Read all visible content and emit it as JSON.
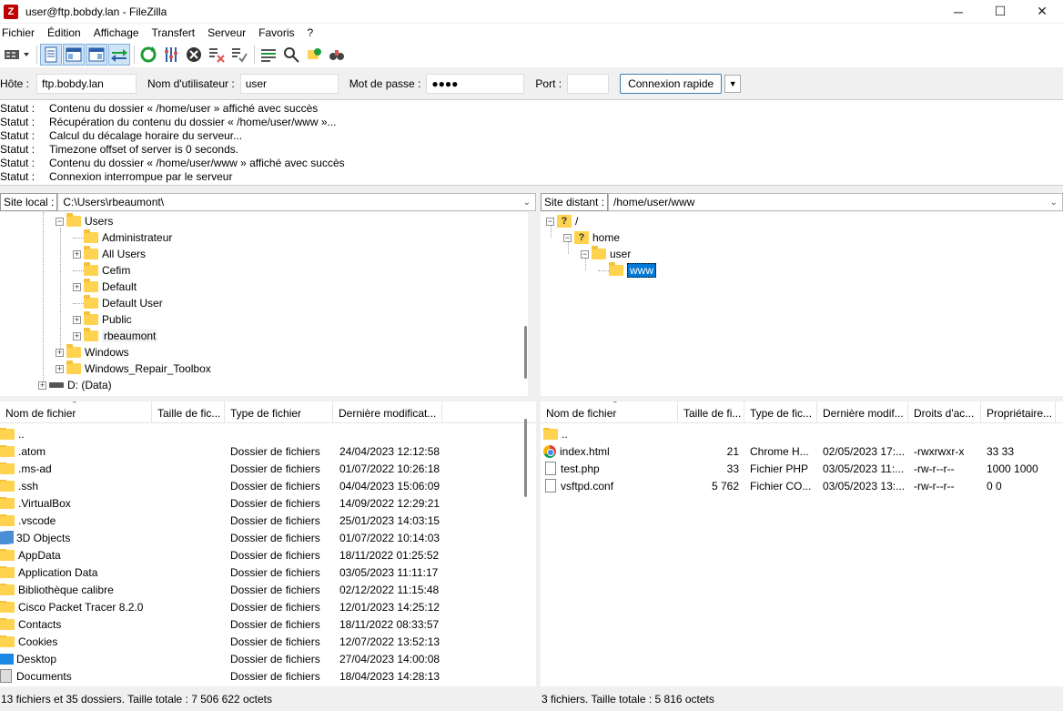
{
  "window": {
    "title": "user@ftp.bobdy.lan - FileZilla",
    "app_icon_letter": "Z",
    "minimize_glyph": "─",
    "maximize_glyph": "☐",
    "close_glyph": "✕"
  },
  "menu": [
    "Fichier",
    "Édition",
    "Affichage",
    "Transfert",
    "Serveur",
    "Favoris",
    "?"
  ],
  "toolbar": {
    "icons": [
      "site-manager-icon",
      "toggle-log-icon",
      "toggle-local-tree-icon",
      "toggle-remote-tree-icon",
      "toggle-queue-icon",
      "refresh-icon",
      "process-queue-icon",
      "cancel-icon",
      "disconnect-icon",
      "reconnect-icon",
      "directory-filter-icon",
      "search-files-icon",
      "sync-browsing-icon",
      "find-icon"
    ]
  },
  "quickconnect": {
    "host_label": "Hôte :",
    "host_value": "ftp.bobdy.lan",
    "user_label": "Nom d'utilisateur :",
    "user_value": "user",
    "pass_label": "Mot de passe :",
    "pass_value": "●●●●",
    "port_label": "Port :",
    "port_value": "",
    "connect_button": "Connexion rapide",
    "dropdown_glyph": "▼"
  },
  "status_log": [
    {
      "label": "Statut :",
      "message": "Contenu du dossier « /home/user » affiché avec succès"
    },
    {
      "label": "Statut :",
      "message": "Récupération du contenu du dossier « /home/user/www »..."
    },
    {
      "label": "Statut :",
      "message": "Calcul du décalage horaire du serveur..."
    },
    {
      "label": "Statut :",
      "message": "Timezone offset of server is 0 seconds."
    },
    {
      "label": "Statut :",
      "message": "Contenu du dossier « /home/user/www » affiché avec succès"
    },
    {
      "label": "Statut :",
      "message": "Connexion interrompue par le serveur"
    }
  ],
  "local": {
    "site_label": "Site local :",
    "site_path": "C:\\Users\\rbeaumont\\",
    "tree": [
      {
        "name": "Users",
        "expander": "−",
        "level": 0
      },
      {
        "name": "Administrateur",
        "expander": "",
        "level": 1
      },
      {
        "name": "All Users",
        "expander": "+",
        "level": 1
      },
      {
        "name": "Cefim",
        "expander": "",
        "level": 1
      },
      {
        "name": "Default",
        "expander": "+",
        "level": 1
      },
      {
        "name": "Default User",
        "expander": "",
        "level": 1
      },
      {
        "name": "Public",
        "expander": "+",
        "level": 1
      },
      {
        "name": "rbeaumont",
        "expander": "+",
        "level": 1
      },
      {
        "name": "Windows",
        "expander": "+",
        "level": 0
      },
      {
        "name": "Windows_Repair_Toolbox",
        "expander": "+",
        "level": 0
      },
      {
        "name": "D: (Data)",
        "expander": "+",
        "level": -1
      }
    ],
    "columns": [
      "Nom de fichier",
      "Taille de fic...",
      "Type de fichier",
      "Dernière modificat..."
    ],
    "files": [
      {
        "name": "..",
        "size": "",
        "type": "",
        "date": "",
        "icon": "folder"
      },
      {
        "name": ".atom",
        "size": "",
        "type": "Dossier de fichiers",
        "date": "24/04/2023 12:12:58",
        "icon": "folder"
      },
      {
        "name": ".ms-ad",
        "size": "",
        "type": "Dossier de fichiers",
        "date": "01/07/2022 10:26:18",
        "icon": "folder"
      },
      {
        "name": ".ssh",
        "size": "",
        "type": "Dossier de fichiers",
        "date": "04/04/2023 15:06:09",
        "icon": "folder"
      },
      {
        "name": ".VirtualBox",
        "size": "",
        "type": "Dossier de fichiers",
        "date": "14/09/2022 12:29:21",
        "icon": "folder"
      },
      {
        "name": ".vscode",
        "size": "",
        "type": "Dossier de fichiers",
        "date": "25/01/2023 14:03:15",
        "icon": "folder"
      },
      {
        "name": "3D Objects",
        "size": "",
        "type": "Dossier de fichiers",
        "date": "01/07/2022 10:14:03",
        "icon": "cube"
      },
      {
        "name": "AppData",
        "size": "",
        "type": "Dossier de fichiers",
        "date": "18/11/2022 01:25:52",
        "icon": "folder"
      },
      {
        "name": "Application Data",
        "size": "",
        "type": "Dossier de fichiers",
        "date": "03/05/2023 11:11:17",
        "icon": "folder"
      },
      {
        "name": "Bibliothèque calibre",
        "size": "",
        "type": "Dossier de fichiers",
        "date": "02/12/2022 11:15:48",
        "icon": "folder"
      },
      {
        "name": "Cisco Packet Tracer 8.2.0",
        "size": "",
        "type": "Dossier de fichiers",
        "date": "12/01/2023 14:25:12",
        "icon": "folder"
      },
      {
        "name": "Contacts",
        "size": "",
        "type": "Dossier de fichiers",
        "date": "18/11/2022 08:33:57",
        "icon": "folder"
      },
      {
        "name": "Cookies",
        "size": "",
        "type": "Dossier de fichiers",
        "date": "12/07/2022 13:52:13",
        "icon": "folder"
      },
      {
        "name": "Desktop",
        "size": "",
        "type": "Dossier de fichiers",
        "date": "27/04/2023 14:00:08",
        "icon": "desktop"
      },
      {
        "name": "Documents",
        "size": "",
        "type": "Dossier de fichiers",
        "date": "18/04/2023 14:28:13",
        "icon": "doc"
      }
    ],
    "status": "13 fichiers et 35 dossiers. Taille totale : 7 506 622 octets"
  },
  "remote": {
    "site_label": "Site distant :",
    "site_path": "/home/user/www",
    "tree": [
      {
        "name": "/",
        "expander": "−",
        "icon": "question"
      },
      {
        "name": "home",
        "expander": "−",
        "icon": "question"
      },
      {
        "name": "user",
        "expander": "−",
        "icon": "folder"
      },
      {
        "name": "www",
        "expander": "",
        "icon": "folder"
      }
    ],
    "columns": [
      "Nom de fichier",
      "Taille de fi...",
      "Type de fic...",
      "Dernière modif...",
      "Droits d'ac...",
      "Propriétaire..."
    ],
    "files": [
      {
        "name": "..",
        "size": "",
        "type": "",
        "date": "",
        "perms": "",
        "owner": "",
        "icon": "folder"
      },
      {
        "name": "index.html",
        "size": "21",
        "type": "Chrome H...",
        "date": "02/05/2023 17:...",
        "perms": "-rwxrwxr-x",
        "owner": "33 33",
        "icon": "chrome"
      },
      {
        "name": "test.php",
        "size": "33",
        "type": "Fichier PHP",
        "date": "03/05/2023 11:...",
        "perms": "-rw-r--r--",
        "owner": "1000 1000",
        "icon": "file"
      },
      {
        "name": "vsftpd.conf",
        "size": "5 762",
        "type": "Fichier CO...",
        "date": "03/05/2023 13:...",
        "perms": "-rw-r--r--",
        "owner": "0 0",
        "icon": "file"
      }
    ],
    "status": "3 fichiers. Taille totale : 5 816 octets"
  }
}
